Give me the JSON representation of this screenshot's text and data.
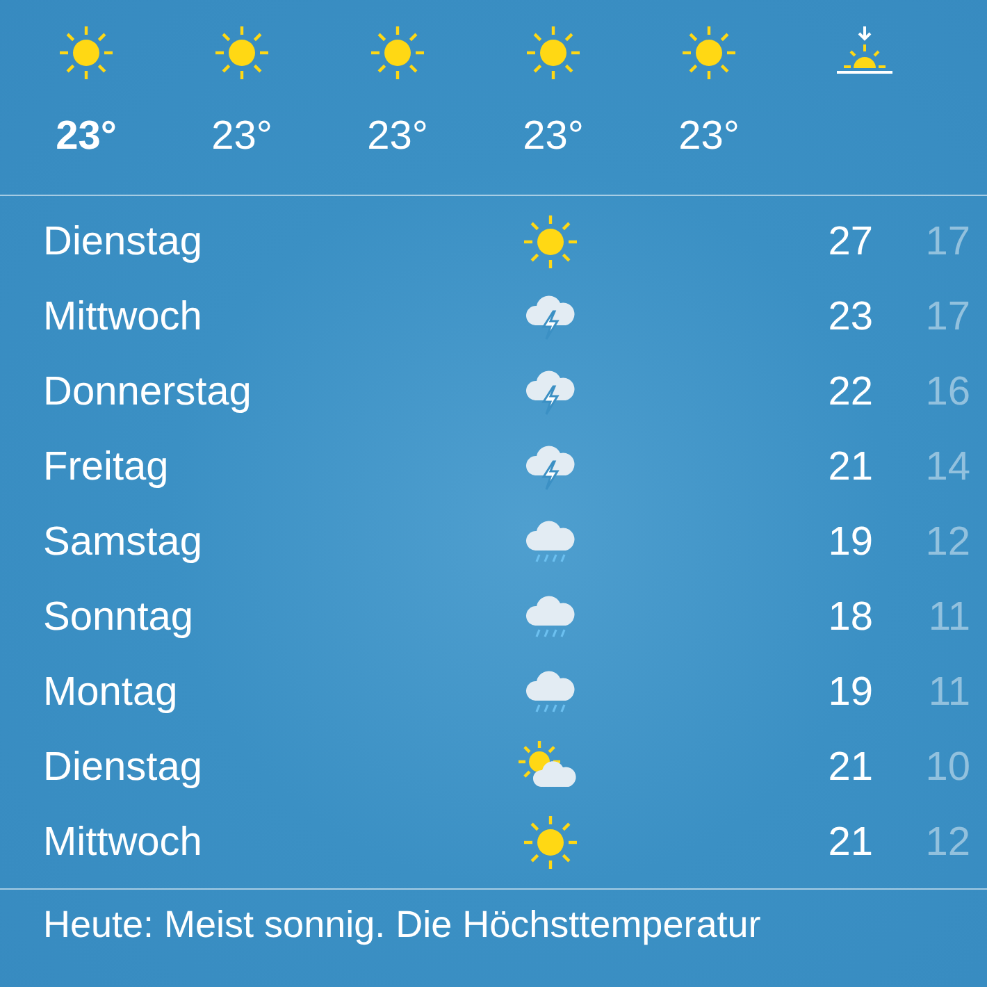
{
  "hourly": [
    {
      "kind": "sunny",
      "temp": "23°",
      "current": true
    },
    {
      "kind": "sunny",
      "temp": "23°",
      "current": false
    },
    {
      "kind": "sunny",
      "temp": "23°",
      "current": false
    },
    {
      "kind": "sunny",
      "temp": "23°",
      "current": false
    },
    {
      "kind": "sunny",
      "temp": "23°",
      "current": false
    },
    {
      "kind": "sunset"
    }
  ],
  "daily": [
    {
      "day": "Dienstag",
      "kind": "sunny",
      "high": "27",
      "low": "17"
    },
    {
      "day": "Mittwoch",
      "kind": "thunderstorm",
      "high": "23",
      "low": "17"
    },
    {
      "day": "Donnerstag",
      "kind": "thunderstorm",
      "high": "22",
      "low": "16"
    },
    {
      "day": "Freitag",
      "kind": "thunderstorm",
      "high": "21",
      "low": "14"
    },
    {
      "day": "Samstag",
      "kind": "rain",
      "high": "19",
      "low": "12"
    },
    {
      "day": "Sonntag",
      "kind": "rain",
      "high": "18",
      "low": "11"
    },
    {
      "day": "Montag",
      "kind": "rain",
      "high": "19",
      "low": "11"
    },
    {
      "day": "Dienstag",
      "kind": "partly-cloudy",
      "high": "21",
      "low": "10"
    },
    {
      "day": "Mittwoch",
      "kind": "sunny",
      "high": "21",
      "low": "12"
    }
  ],
  "summary": "Heute: Meist sonnig. Die Höchsttemperatur"
}
